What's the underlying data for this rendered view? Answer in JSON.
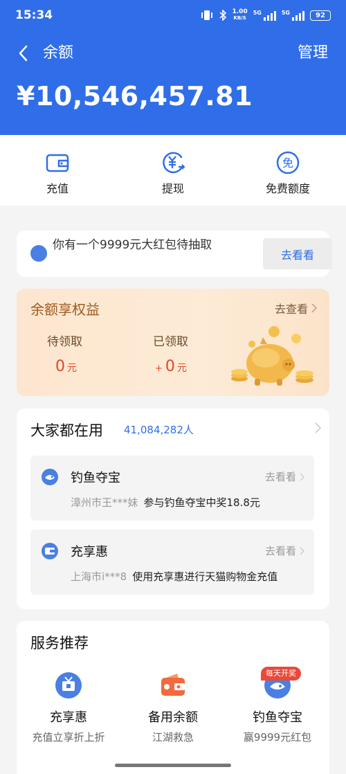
{
  "status_bar": {
    "time": "15:34",
    "network_speed": "1.00",
    "speed_unit": "KB/S",
    "signal_label_1": "5G",
    "signal_label_2": "5G",
    "battery": "92"
  },
  "header": {
    "title": "余额",
    "manage_label": "管理",
    "balance": "¥10,546,457.81"
  },
  "actions": [
    {
      "label": "充值",
      "icon": "wallet-icon"
    },
    {
      "label": "提现",
      "icon": "withdraw-yuan-icon"
    },
    {
      "label": "免费额度",
      "icon": "free-quota-icon"
    }
  ],
  "promo": {
    "text": "你有一个9999元大红包待抽取",
    "button_label": "去看看"
  },
  "benefits": {
    "title": "余额享权益",
    "more_label": "去查看",
    "pending_label": "待领取",
    "pending_value": "0",
    "received_label": "已领取",
    "received_prefix": "+",
    "received_value": "0",
    "unit": "元"
  },
  "popular": {
    "title": "大家都在用",
    "count": "41,084,282人",
    "items": [
      {
        "title": "钓鱼夺宝",
        "more": "去看看",
        "user": "漳州市王***妹",
        "desc": "参与钓鱼夺宝中奖18.8元",
        "icon": "fishing-treasure-icon"
      },
      {
        "title": "充享惠",
        "more": "去看看",
        "user": "上海市i***8",
        "desc": "使用充享惠进行天猫购物金充值",
        "icon": "recharge-wallet-icon"
      }
    ]
  },
  "services": {
    "title": "服务推荐",
    "badge": "每天开奖",
    "items": [
      {
        "name": "充享惠",
        "sub": "充值立享折上折",
        "icon": "gift-tv-icon"
      },
      {
        "name": "备用余额",
        "sub": "江湖救急",
        "icon": "backup-wallet-icon"
      },
      {
        "name": "钓鱼夺宝",
        "sub": "赢9999元红包",
        "icon": "fishing-treasure-icon"
      }
    ]
  },
  "colors": {
    "brand_blue": "#2f6ee8",
    "benefit_orange": "#a05a1e",
    "value_red": "#e2452a",
    "badge_red": "#e84a3a"
  }
}
